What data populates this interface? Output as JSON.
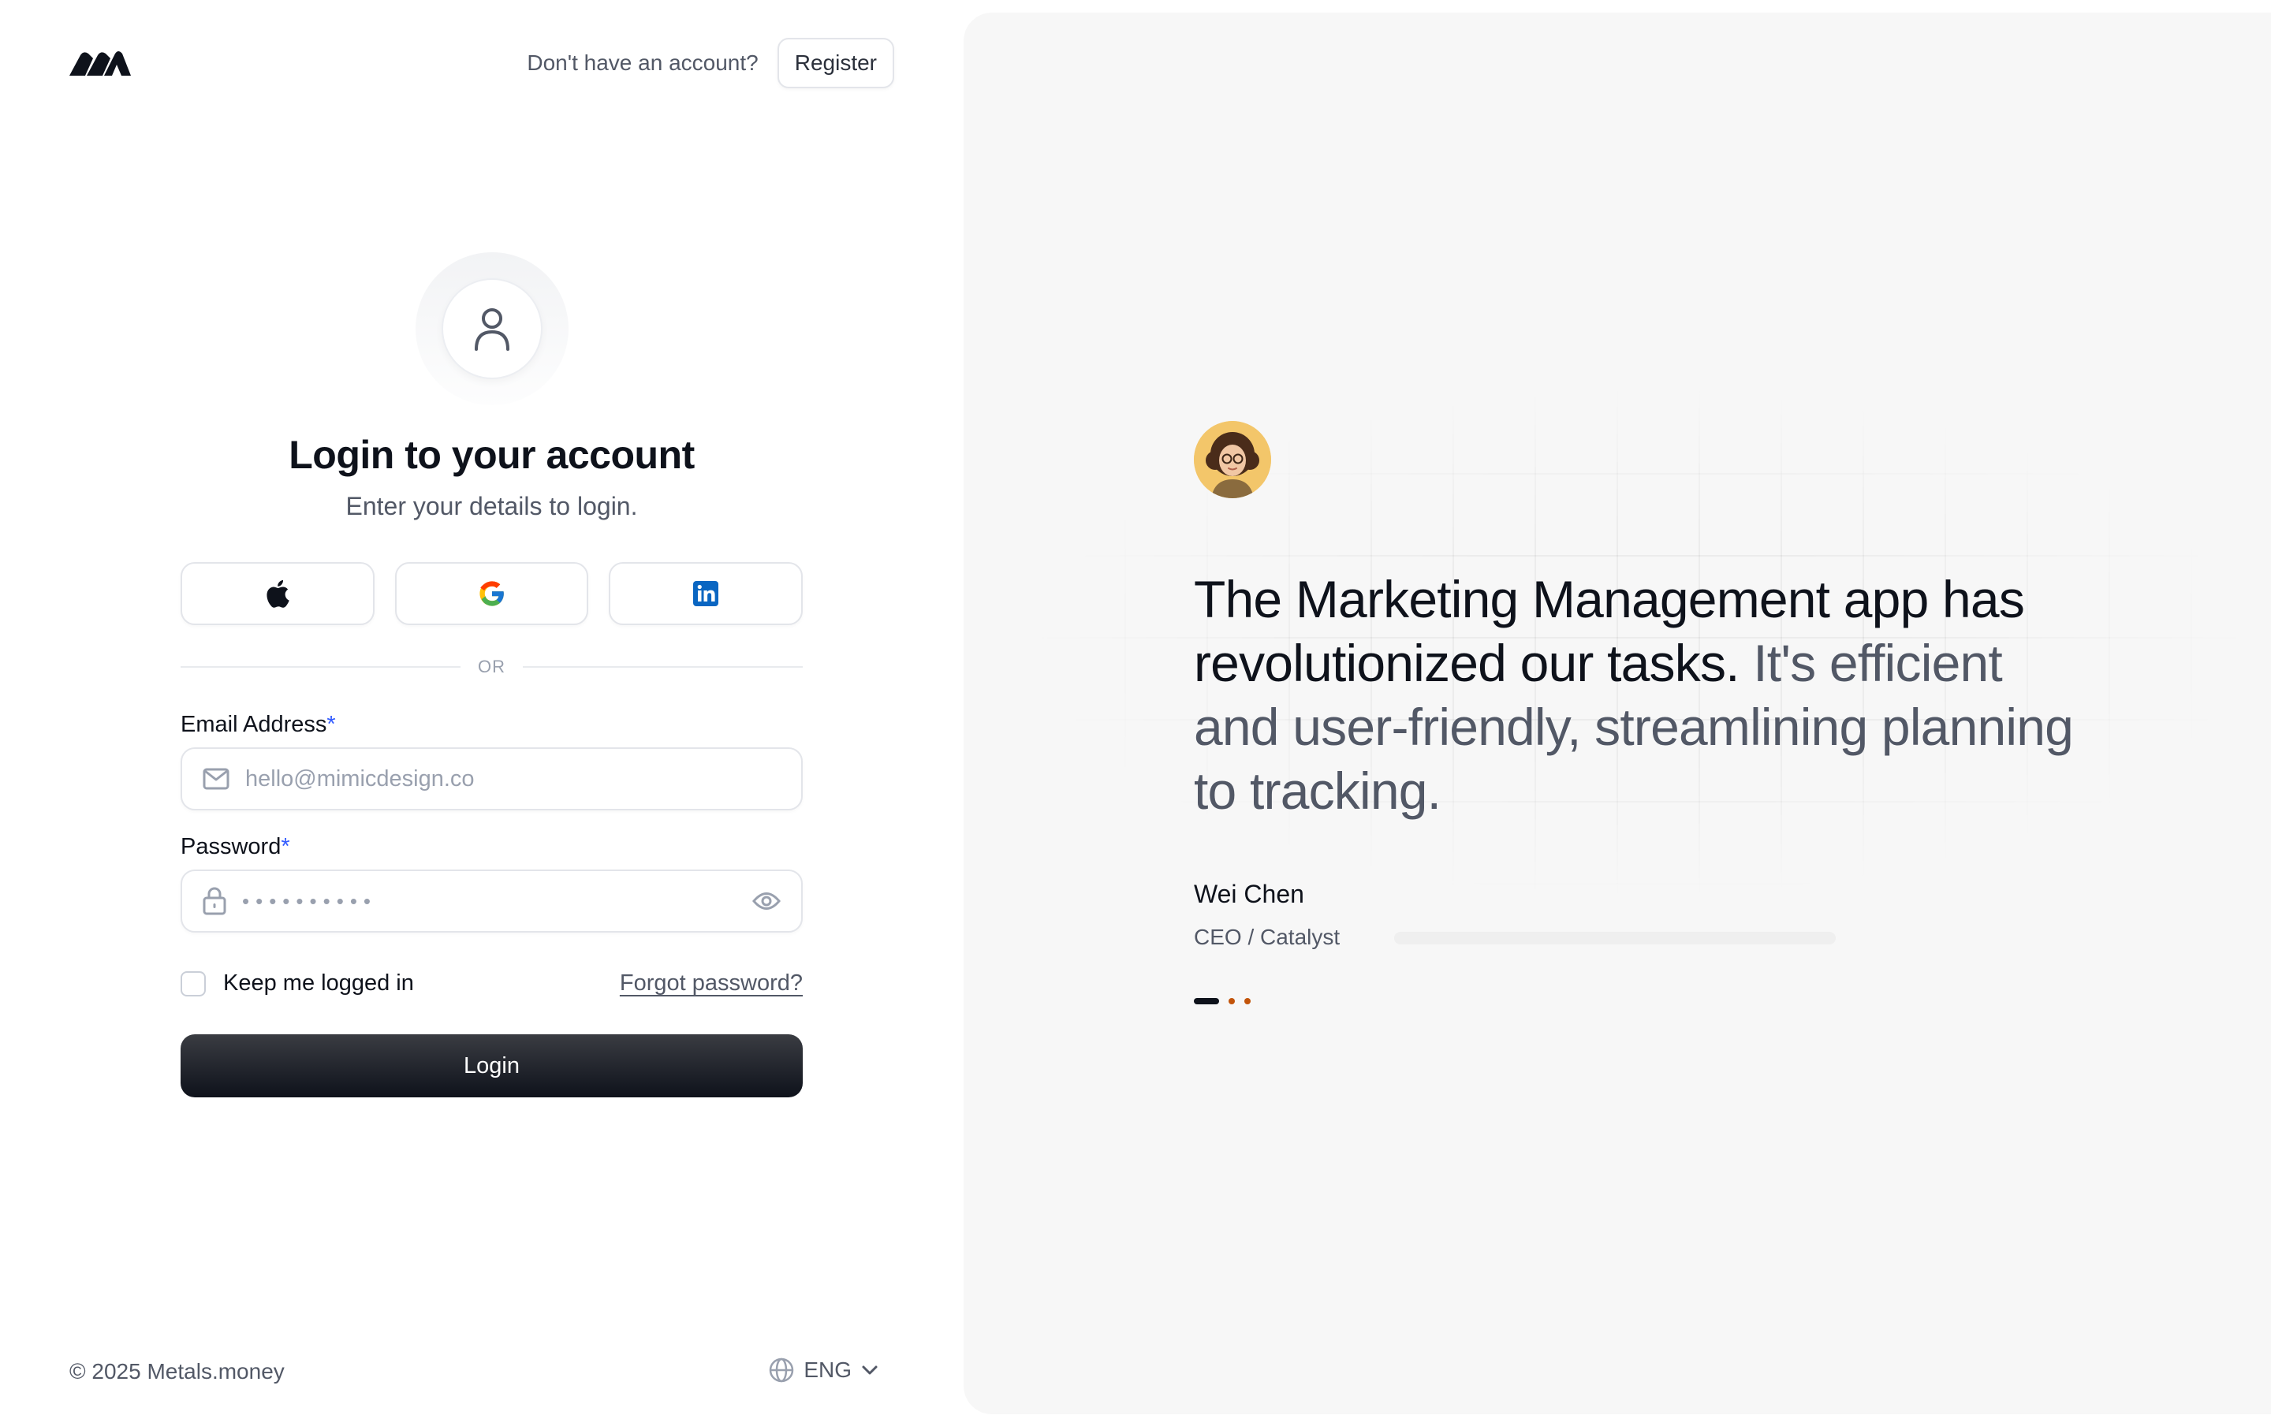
{
  "header": {
    "no_account_text": "Don't have an account?",
    "register_label": "Register"
  },
  "form": {
    "title": "Login to your account",
    "subtitle": "Enter your details to login.",
    "social": [
      "apple-icon",
      "google-icon",
      "linkedin-icon"
    ],
    "divider_text": "OR",
    "email_label": "Email Address",
    "email_required": "*",
    "email_placeholder": "hello@mimicdesign.co",
    "password_label": "Password",
    "password_required": "*",
    "password_mask": "••••••••••",
    "keep_logged_in_label": "Keep me logged in",
    "forgot_password_label": "Forgot password?",
    "login_label": "Login"
  },
  "footer": {
    "copyright": "© 2025 Metals.money",
    "language": "ENG"
  },
  "testimonial": {
    "quote_strong": "The Marketing Management app has revolutionized our tasks.",
    "quote_muted": "It's efficient and user-friendly, streamlining planning to tracking.",
    "author": "Wei Chen",
    "role": "CEO / Catalyst"
  },
  "colors": {
    "accent": "#335cff",
    "primary_button": "#0e121b",
    "panel_bg": "#f7f7f7",
    "pager_dot": "#c2540a"
  }
}
